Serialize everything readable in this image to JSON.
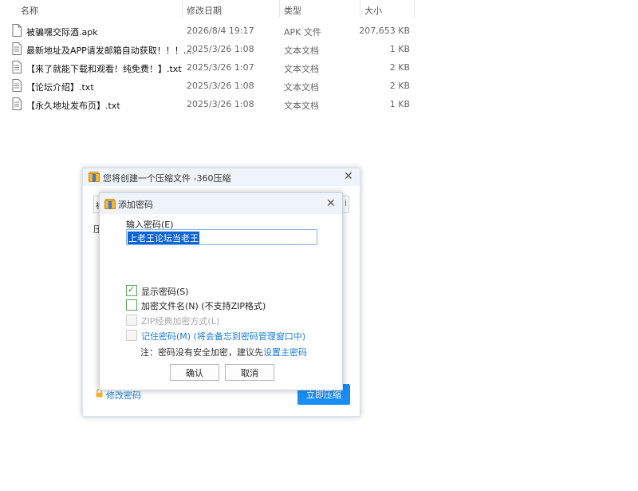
{
  "explorer": {
    "columns": {
      "name": "名称",
      "modified": "修改日期",
      "type": "类型",
      "size": "大小"
    },
    "files": [
      {
        "name": "被骗嘿交际酒.apk",
        "modified": "2026/8/4 19:17",
        "type": "APK 文件",
        "size": "207,653 KB",
        "icon": "file-icon"
      },
      {
        "name": "最新地址及APP请发邮箱自动获取！！！....",
        "modified": "2025/3/26 1:08",
        "type": "文本文档",
        "size": "1 KB",
        "icon": "text-file-icon"
      },
      {
        "name": "【来了就能下载和观看！纯免费！】.txt",
        "modified": "2025/3/26 1:07",
        "type": "文本文档",
        "size": "2 KB",
        "icon": "text-file-icon"
      },
      {
        "name": "【论坛介绍】.txt",
        "modified": "2025/3/26 1:08",
        "type": "文本文档",
        "size": "2 KB",
        "icon": "text-file-icon"
      },
      {
        "name": "【永久地址发布页】.txt",
        "modified": "2025/3/26 1:08",
        "type": "文本文档",
        "size": "1 KB",
        "icon": "text-file-icon"
      }
    ]
  },
  "zip_dialog": {
    "title": "您将创建一个压缩文件 -360压缩",
    "field_fragment_left": "被",
    "field_fragment_right": "i",
    "label_fragment": "压",
    "modify_password": "修改密码",
    "start_button": "立即压缩",
    "colors": {
      "accent": "#1a8ef5",
      "link": "#1c7dd6"
    }
  },
  "password_dialog": {
    "title": "添加密码",
    "input_label": "输入密码(E)",
    "input_value": "上老王论坛当老王",
    "options": [
      {
        "label": "显示密码(S)",
        "checked": true,
        "disabled": false
      },
      {
        "label": "加密文件名(N) (不支持ZIP格式)",
        "checked": false,
        "disabled": false
      },
      {
        "label": "ZIP经典加密方式(L)",
        "checked": false,
        "disabled": true
      },
      {
        "label": "记住密码(M) (将会备忘到密码管理窗口中)",
        "checked": false,
        "disabled": false
      }
    ],
    "note_text": "注：密码没有安全加密，建议先",
    "note_link": "设置主密码",
    "ok_button": "确认",
    "cancel_button": "取消"
  }
}
